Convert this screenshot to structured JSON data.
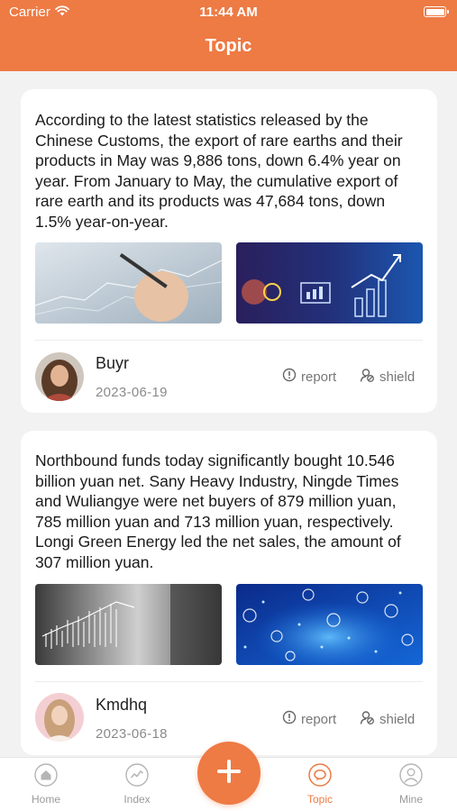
{
  "status_bar": {
    "carrier": "Carrier",
    "time": "11:44 AM"
  },
  "nav": {
    "title": "Topic"
  },
  "posts": [
    {
      "text": "According to the latest statistics released by the Chinese Customs, the export of rare earths and their products in May was 9,886 tons, down 6.4% year on year. From January to May, the cumulative export of rare earth and its products was 47,684 tons, down 1.5% year-on-year.",
      "author": "Buyr",
      "date": "2023-06-19",
      "report_label": "report",
      "shield_label": "shield"
    },
    {
      "text": "Northbound funds today significantly bought 10.546 billion yuan net. Sany Heavy Industry, Ningde Times and Wuliangye were net buyers of 879 million yuan, 785 million yuan and 713 million yuan, respectively. Longi Green Energy led the net sales, the amount of 307 million yuan.",
      "author": "Kmdhq",
      "date": "2023-06-18",
      "report_label": "report",
      "shield_label": "shield"
    }
  ],
  "tabbar": {
    "items": [
      {
        "label": "Home",
        "icon": "home-icon"
      },
      {
        "label": "Index",
        "icon": "chart-icon"
      },
      {
        "label": "Topic",
        "icon": "chat-icon",
        "active": true
      },
      {
        "label": "Mine",
        "icon": "user-icon"
      }
    ],
    "fab_icon": "plus-icon"
  },
  "colors": {
    "accent": "#ee7a44",
    "background": "#f2f2f2",
    "text_muted": "#8a8a8a"
  }
}
